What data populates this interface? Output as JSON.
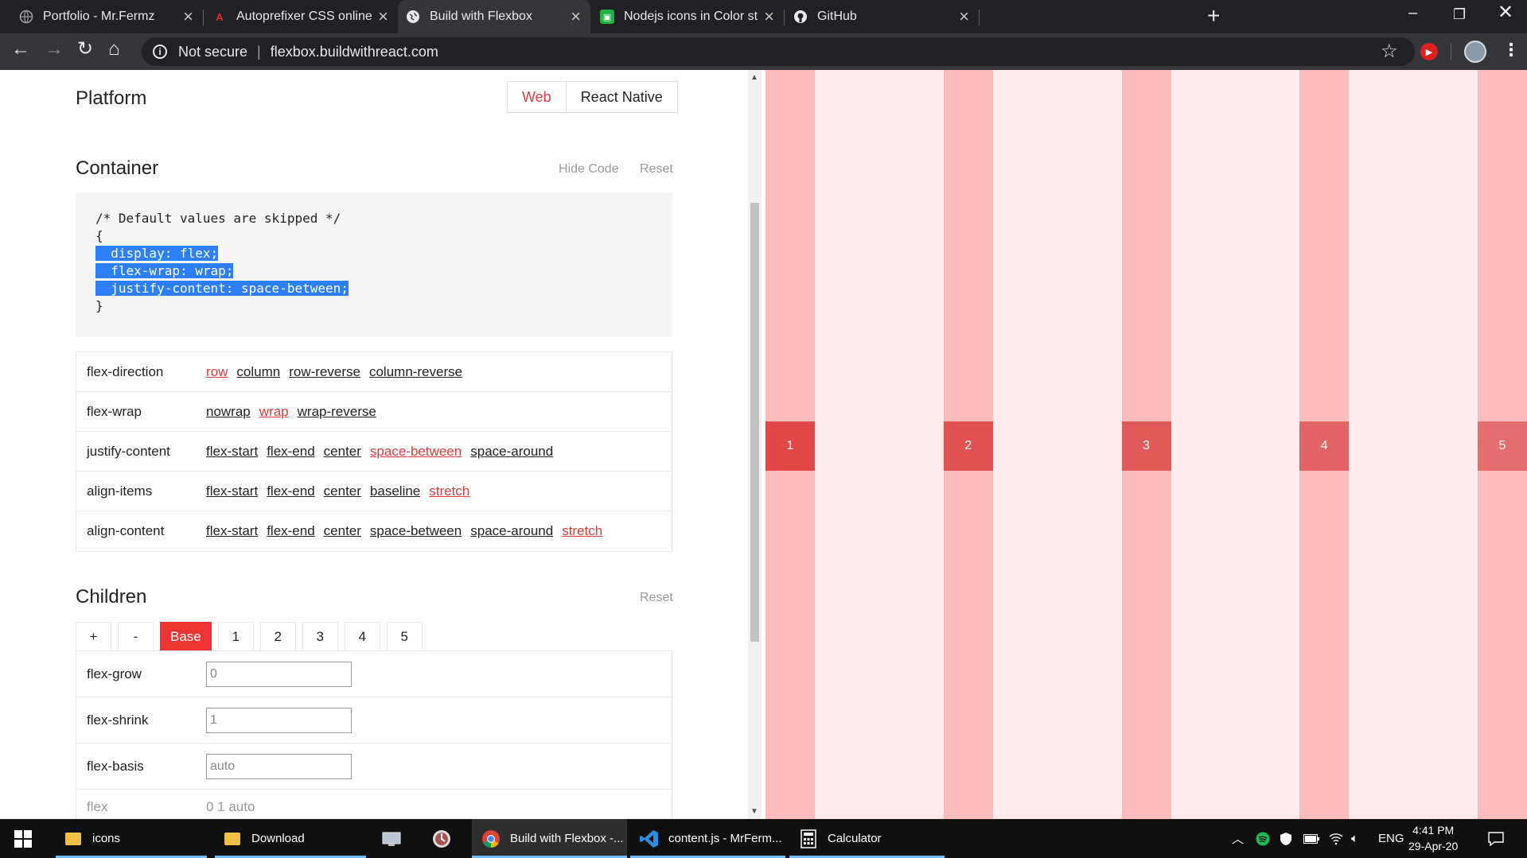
{
  "browser": {
    "tabs": [
      {
        "title": "Portfolio - Mr.Fermz",
        "icon": "globe-icon",
        "active": false
      },
      {
        "title": "Autoprefixer CSS online",
        "icon": "autoprefixer-icon",
        "active": false
      },
      {
        "title": "Build with Flexbox",
        "icon": "globe-icon",
        "active": true
      },
      {
        "title": "Nodejs icons in Color style for gr",
        "icon": "icons8-icon",
        "active": false
      },
      {
        "title": "GitHub",
        "icon": "github-icon",
        "active": false
      }
    ],
    "security_label": "Not secure",
    "url": "flexbox.buildwithreact.com"
  },
  "platform": {
    "heading": "Platform",
    "options": [
      "Web",
      "React Native"
    ],
    "selected": "Web"
  },
  "container": {
    "heading": "Container",
    "hide_code": "Hide Code",
    "reset": "Reset",
    "code": {
      "comment": "/* Default values are skipped */",
      "open": "{",
      "lines": [
        "  display: flex;",
        "  flex-wrap: wrap;",
        "  justify-content: space-between;"
      ],
      "close": "}"
    },
    "properties": [
      {
        "name": "flex-direction",
        "options": [
          "row",
          "column",
          "row-reverse",
          "column-reverse"
        ],
        "selected": "row"
      },
      {
        "name": "flex-wrap",
        "options": [
          "nowrap",
          "wrap",
          "wrap-reverse"
        ],
        "selected": "wrap"
      },
      {
        "name": "justify-content",
        "options": [
          "flex-start",
          "flex-end",
          "center",
          "space-between",
          "space-around"
        ],
        "selected": "space-between"
      },
      {
        "name": "align-items",
        "options": [
          "flex-start",
          "flex-end",
          "center",
          "baseline",
          "stretch"
        ],
        "selected": "stretch"
      },
      {
        "name": "align-content",
        "options": [
          "flex-start",
          "flex-end",
          "center",
          "space-between",
          "space-around",
          "stretch"
        ],
        "selected": "stretch"
      }
    ]
  },
  "children": {
    "heading": "Children",
    "reset": "Reset",
    "tabs": [
      "+",
      "-",
      "Base",
      "1",
      "2",
      "3",
      "4",
      "5"
    ],
    "selected_tab": "Base",
    "fields": [
      {
        "name": "flex-grow",
        "value": "0"
      },
      {
        "name": "flex-shrink",
        "value": "1"
      },
      {
        "name": "flex-basis",
        "value": "auto"
      }
    ],
    "flex": {
      "name": "flex",
      "value": "0 1 auto"
    }
  },
  "preview": {
    "items": [
      "1",
      "2",
      "3",
      "4",
      "5"
    ],
    "item_colors": [
      "#e04848",
      "#e05252",
      "#e05a5a",
      "#e26464",
      "#e46e6e"
    ]
  },
  "taskbar": {
    "apps": [
      {
        "label": "icons",
        "icon": "folder-icon"
      },
      {
        "label": "Download",
        "icon": "folder-icon"
      },
      {
        "label": "",
        "icon": "remote-desktop-icon"
      },
      {
        "label": "",
        "icon": "app-circle-icon"
      },
      {
        "label": "Build with Flexbox -...",
        "icon": "chrome-icon"
      },
      {
        "label": "content.js - MrFerm...",
        "icon": "vscode-icon"
      },
      {
        "label": "Calculator",
        "icon": "calculator-icon"
      }
    ],
    "language": "ENG",
    "time": "4:41 PM",
    "date": "29-Apr-20"
  }
}
